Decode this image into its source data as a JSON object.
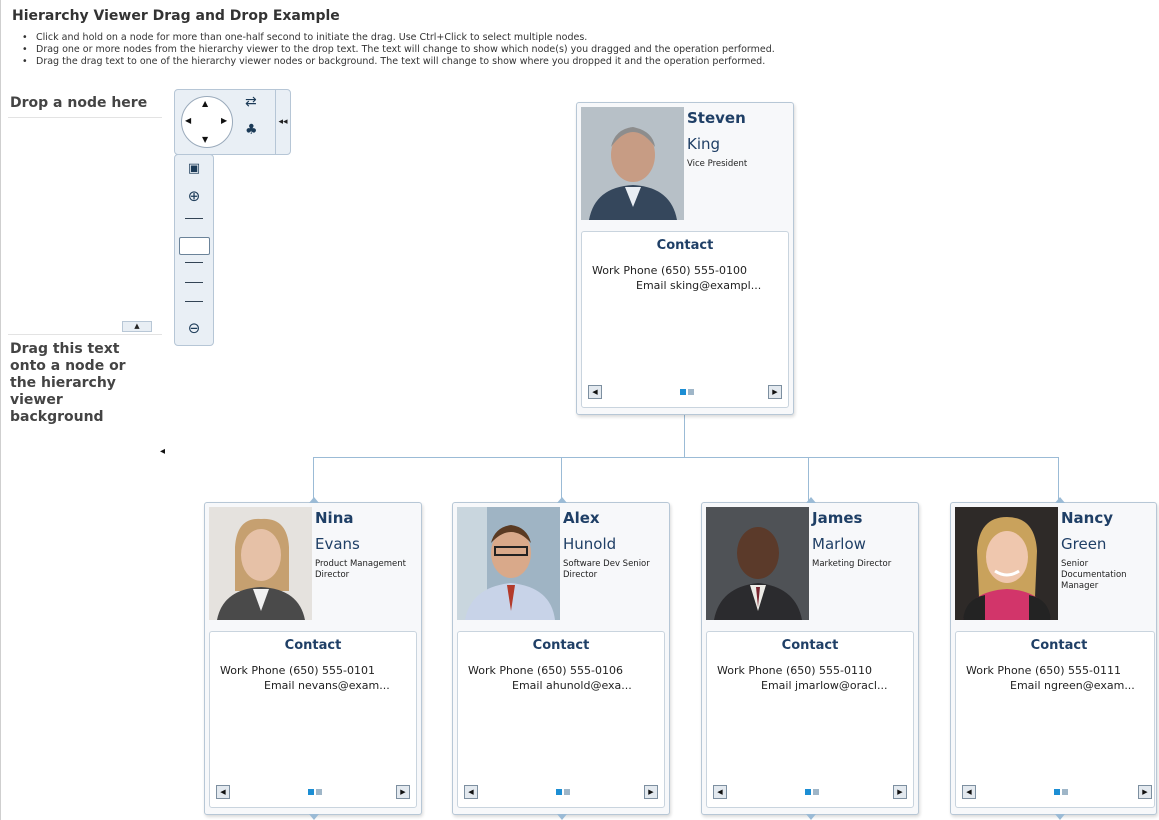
{
  "page": {
    "title": "Hierarchy Viewer Drag and Drop Example",
    "instructions": [
      "Click and hold on a node for more than one-half second to initiate the drag. Use Ctrl+Click to select multiple nodes.",
      "Drag one or more nodes from the hierarchy viewer to the drop text. The text will change to show which node(s) you dragged and the operation performed.",
      "Drag the drag text to one of the hierarchy viewer nodes or background. The text will change to show where you dropped it and the operation performed."
    ]
  },
  "left_panel": {
    "drop_label": "Drop a node here",
    "drag_text": "Drag this text onto a node or the hierarchy viewer background"
  },
  "colors": {
    "name": "#1f3f66",
    "accent": "#1c8ed4",
    "connector": "#9bbbd6"
  },
  "icons": {
    "pan": "pan-control-icon",
    "layout": "layout-icon",
    "hierarchy": "hierarchy-icon",
    "zoom_fit": "zoom-to-fit-icon",
    "zoom_in": "zoom-in-icon",
    "zoom_out": "zoom-out-icon"
  },
  "nodes": [
    {
      "first": "Steven",
      "last": "King",
      "title": "Vice President",
      "contact_header": "Contact",
      "phone_label": "Work Phone",
      "phone": "(650) 555-0100",
      "email_label": "Email",
      "email": "sking@exampl..."
    },
    {
      "first": "Nina",
      "last": "Evans",
      "title": "Product Management Director",
      "contact_header": "Contact",
      "phone_label": "Work Phone",
      "phone": "(650) 555-0101",
      "email_label": "Email",
      "email": "nevans@exam..."
    },
    {
      "first": "Alex",
      "last": "Hunold",
      "title": "Software Dev Senior Director",
      "contact_header": "Contact",
      "phone_label": "Work Phone",
      "phone": "(650) 555-0106",
      "email_label": "Email",
      "email": "ahunold@exa..."
    },
    {
      "first": "James",
      "last": "Marlow",
      "title": "Marketing Director",
      "contact_header": "Contact",
      "phone_label": "Work Phone",
      "phone": "(650) 555-0110",
      "email_label": "Email",
      "email": "jmarlow@oracl..."
    },
    {
      "first": "Nancy",
      "last": "Green",
      "title": "Senior Documentation Manager",
      "contact_header": "Contact",
      "phone_label": "Work Phone",
      "phone": "(650) 555-0111",
      "email_label": "Email",
      "email": "ngreen@exam..."
    }
  ]
}
